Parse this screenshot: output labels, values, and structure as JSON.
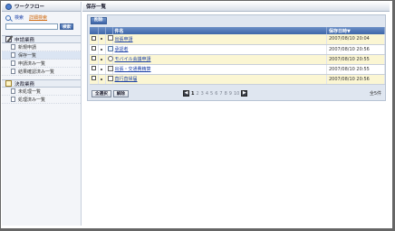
{
  "sidebar": {
    "title": "ワークフロー",
    "search_label": "検索",
    "detail_search_link": "詳細検索",
    "search_input_value": "",
    "search_button": "検索",
    "sections": [
      {
        "title": "申請業務",
        "items": [
          "新規申請",
          "保存一覧",
          "申請済み一覧",
          "結果確認済み一覧"
        ],
        "active_index": 1
      },
      {
        "title": "決裁業務",
        "items": [
          "未処理一覧",
          "処理済み一覧"
        ]
      }
    ]
  },
  "main": {
    "title": "保存一覧",
    "delete_button": "削除",
    "table": {
      "headers": {
        "name": "件名",
        "date": "保存日時▼"
      },
      "rows": [
        {
          "name": "出張申請",
          "date": "2007/08/10 20:04",
          "icon": "file-icon"
        },
        {
          "name": "承認者",
          "date": "2007/08/10 20:56",
          "icon": "mail-icon"
        },
        {
          "name": "モバイル会議申請",
          "date": "2007/08/10 20:55",
          "icon": "circle-doc-icon"
        },
        {
          "name": "出張・交通費精算",
          "date": "2007/08/10 20:55",
          "icon": "document-icon"
        },
        {
          "name": "直行直帰届",
          "date": "2007/08/10 20:56",
          "icon": "file-icon"
        }
      ]
    },
    "pager": {
      "select_all_button": "全選択",
      "clear_button": "解除",
      "prev": "◀",
      "next": "▶",
      "pages": [
        "1",
        "2",
        "3",
        "4",
        "5",
        "6",
        "7",
        "8",
        "9",
        "10"
      ],
      "current_page": "1",
      "total": "全5件"
    }
  }
}
